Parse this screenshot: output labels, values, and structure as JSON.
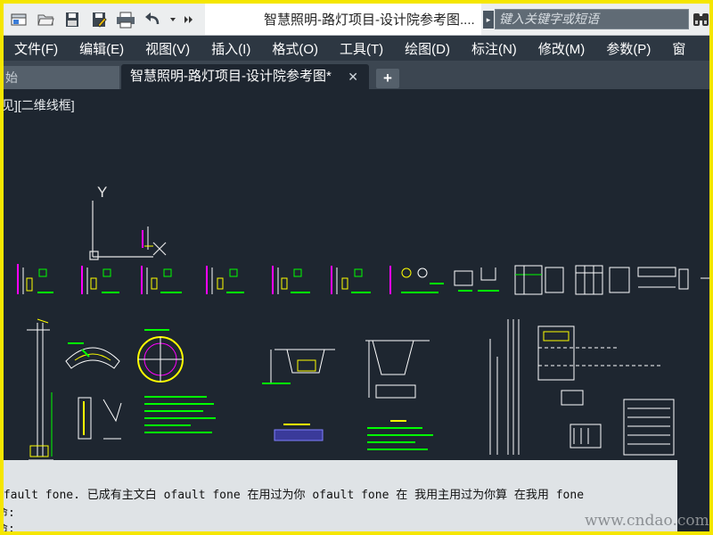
{
  "window": {
    "document_title": "智慧照明-路灯项目-设计院参考图....",
    "search_placeholder": "键入关键字或短语"
  },
  "menu": {
    "items": [
      "文件(F)",
      "编辑(E)",
      "视图(V)",
      "插入(I)",
      "格式(O)",
      "工具(T)",
      "绘图(D)",
      "标注(N)",
      "修改(M)",
      "参数(P)",
      "窗"
    ]
  },
  "tabs": {
    "start_label": "始",
    "active_label": "智慧照明-路灯项目-设计院参考图*",
    "close_glyph": "✕",
    "add_glyph": "+"
  },
  "viewport": {
    "label": "见][二维线框]",
    "ucs_y_label": "Y"
  },
  "command": {
    "line1": "ofault fone. 已成有主文白 ofault fone 在用过为你 ofault fone 在 我用主用过为你算 在我用 fone",
    "line2": "命:",
    "line3": "命:"
  },
  "watermark": "www.cndao.com",
  "colors": {
    "background": "#1e2630",
    "accent": "#f5e600",
    "drawing_green": "#00ff00",
    "drawing_white": "#ffffff",
    "drawing_magenta": "#ff00ff",
    "drawing_yellow": "#ffff00",
    "drawing_cyan": "#00ffff"
  }
}
